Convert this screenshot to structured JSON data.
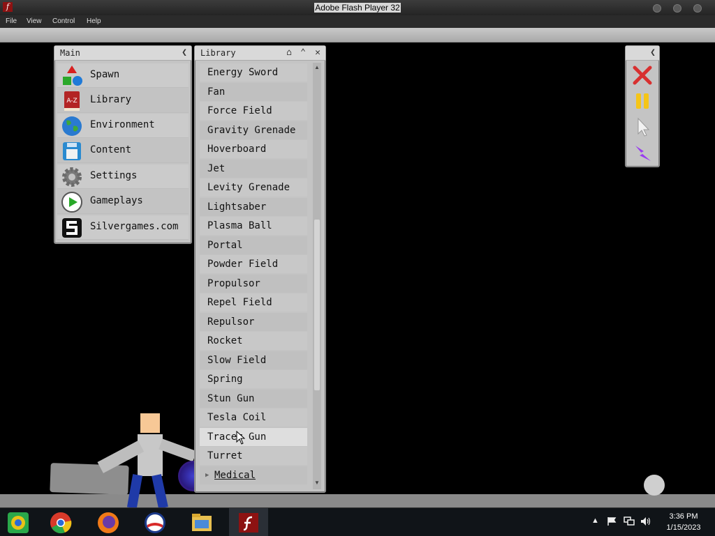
{
  "window": {
    "title": "Adobe Flash Player 32"
  },
  "menu": [
    "File",
    "View",
    "Control",
    "Help"
  ],
  "main_panel": {
    "title": "Main",
    "items": [
      {
        "label": "Spawn",
        "icon": "shapes-icon"
      },
      {
        "label": "Library",
        "icon": "book-icon"
      },
      {
        "label": "Environment",
        "icon": "globe-icon"
      },
      {
        "label": "Content",
        "icon": "floppy-disk-icon"
      },
      {
        "label": "Settings",
        "icon": "gear-icon"
      },
      {
        "label": "Gameplays",
        "icon": "play-icon"
      },
      {
        "label": "Silvergames.com",
        "icon": "silvergames-logo-icon"
      }
    ],
    "book_icon_text": "A-Z"
  },
  "library_panel": {
    "title": "Library",
    "items": [
      "Energy Sword",
      "Fan",
      "Force Field",
      "Gravity Grenade",
      "Hoverboard",
      "Jet",
      "Levity Grenade",
      "Lightsaber",
      "Plasma Ball",
      "Portal",
      "Powder Field",
      "Propulsor",
      "Repel Field",
      "Repulsor",
      "Rocket",
      "Slow Field",
      "Spring",
      "Stun Gun",
      "Tesla Coil",
      "Tracer Gun",
      "Turret"
    ],
    "hovered_item": "Tracer Gun",
    "category": "Medical"
  },
  "tool_panel": {
    "tools": [
      "delete-tool-icon",
      "pause-icon",
      "pointer-icon",
      "lightning-icon"
    ]
  },
  "taskbar": {
    "apps": [
      "chrome-legacy-icon",
      "chrome-icon",
      "firefox-icon",
      "obama-logo-icon",
      "file-explorer-icon",
      "flash-player-icon"
    ],
    "time": "3:36 PM",
    "date": "1/15/2023"
  },
  "colors": {
    "panel_bg": "#c4c4c4",
    "title_bar": "#2b2b2b",
    "taskbar": "#101418"
  }
}
